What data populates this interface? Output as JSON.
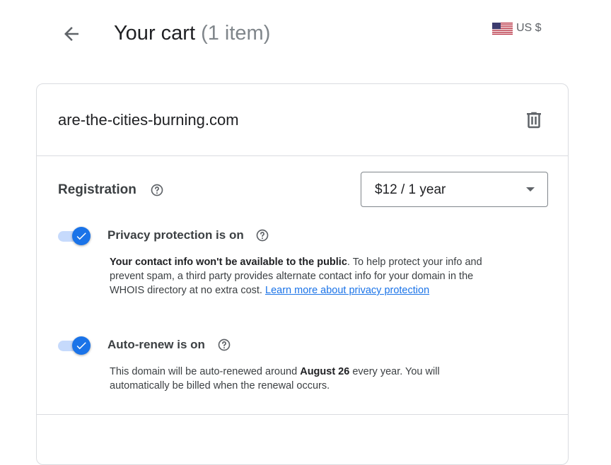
{
  "header": {
    "title": "Your cart",
    "item_count": "(1 item)",
    "currency": "US $",
    "currency_flag": "us-flag-icon"
  },
  "cart_item": {
    "domain": "are-the-cities-burning.com",
    "registration": {
      "label": "Registration",
      "selected_term": "$12 / 1 year"
    },
    "privacy": {
      "title": "Privacy protection is on",
      "enabled": true,
      "desc_bold": "Your contact info won't be available to the public",
      "desc_text": ". To help protect your info and prevent spam, a third party provides alternate contact info for your domain in the WHOIS directory at no extra cost. ",
      "link": "Learn more about privacy protection"
    },
    "auto_renew": {
      "title": "Auto-renew is on",
      "enabled": true,
      "desc_pre": "This domain will be auto-renewed around ",
      "desc_date": "August 26",
      "desc_post": " every year. You will automatically be billed when the renewal occurs."
    }
  },
  "colors": {
    "accent": "#1a73e8",
    "toggle_track": "#c6dafc",
    "border": "#dadce0",
    "text_primary": "#202124",
    "text_secondary": "#5f6368"
  }
}
